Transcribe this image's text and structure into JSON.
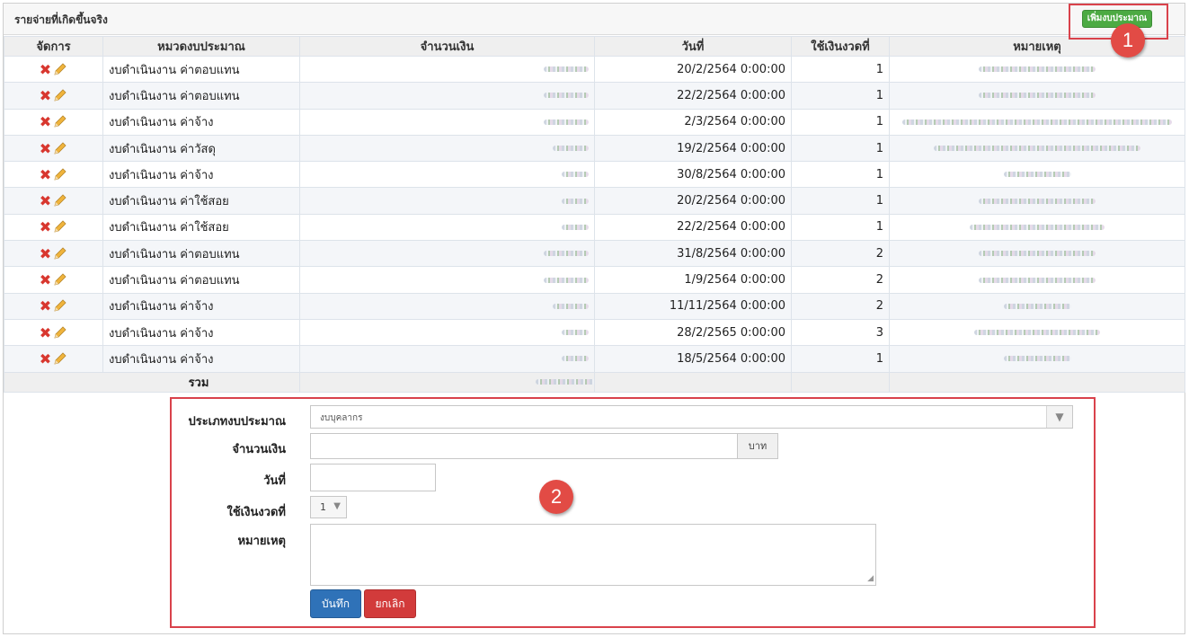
{
  "panel": {
    "title": "รายจ่ายที่เกิดขึ้นจริง",
    "add_button_label": "เพิ่มงบประมาณ"
  },
  "callouts": [
    "1",
    "2"
  ],
  "table": {
    "columns": [
      "จัดการ",
      "หมวดงบประมาณ",
      "จำนวนเงิน",
      "วันที่",
      "ใช้เงินงวดที่",
      "หมายเหตุ"
    ],
    "rows": [
      {
        "category": "งบดำเนินงาน ค่าตอบแทน",
        "date": "20/2/2564 0:00:00",
        "installment": "1"
      },
      {
        "category": "งบดำเนินงาน ค่าตอบแทน",
        "date": "22/2/2564 0:00:00",
        "installment": "1"
      },
      {
        "category": "งบดำเนินงาน ค่าจ้าง",
        "date": "2/3/2564 0:00:00",
        "installment": "1"
      },
      {
        "category": "งบดำเนินงาน ค่าวัสดุ",
        "date": "19/2/2564 0:00:00",
        "installment": "1"
      },
      {
        "category": "งบดำเนินงาน ค่าจ้าง",
        "date": "30/8/2564 0:00:00",
        "installment": "1"
      },
      {
        "category": "งบดำเนินงาน ค่าใช้สอย",
        "date": "20/2/2564 0:00:00",
        "installment": "1"
      },
      {
        "category": "งบดำเนินงาน ค่าใช้สอย",
        "date": "22/2/2564 0:00:00",
        "installment": "1"
      },
      {
        "category": "งบดำเนินงาน ค่าตอบแทน",
        "date": "31/8/2564 0:00:00",
        "installment": "2"
      },
      {
        "category": "งบดำเนินงาน ค่าตอบแทน",
        "date": "1/9/2564 0:00:00",
        "installment": "2"
      },
      {
        "category": "งบดำเนินงาน ค่าจ้าง",
        "date": "11/11/2564 0:00:00",
        "installment": "2"
      },
      {
        "category": "งบดำเนินงาน ค่าจ้าง",
        "date": "28/2/2565 0:00:00",
        "installment": "3"
      },
      {
        "category": "งบดำเนินงาน ค่าจ้าง",
        "date": "18/5/2564 0:00:00",
        "installment": "1"
      }
    ],
    "total_label": "รวม"
  },
  "form": {
    "budget_type_label": "ประเภทงบประมาณ",
    "budget_type_value": "งบบุคลากร",
    "amount_label": "จำนวนเงิน",
    "amount_value": "",
    "amount_unit": "บาท",
    "date_label": "วันที่",
    "date_value": "",
    "installment_label": "ใช้เงินงวดที่",
    "installment_value": "1",
    "note_label": "หมายเหตุ",
    "note_value": "",
    "save_label": "บันทึก",
    "cancel_label": "ยกเลิก"
  },
  "colors": {
    "accent_green": "#4caa43",
    "save_blue": "#2f72b8",
    "cancel_red": "#d23b3b",
    "callout_red": "#e24b45"
  }
}
